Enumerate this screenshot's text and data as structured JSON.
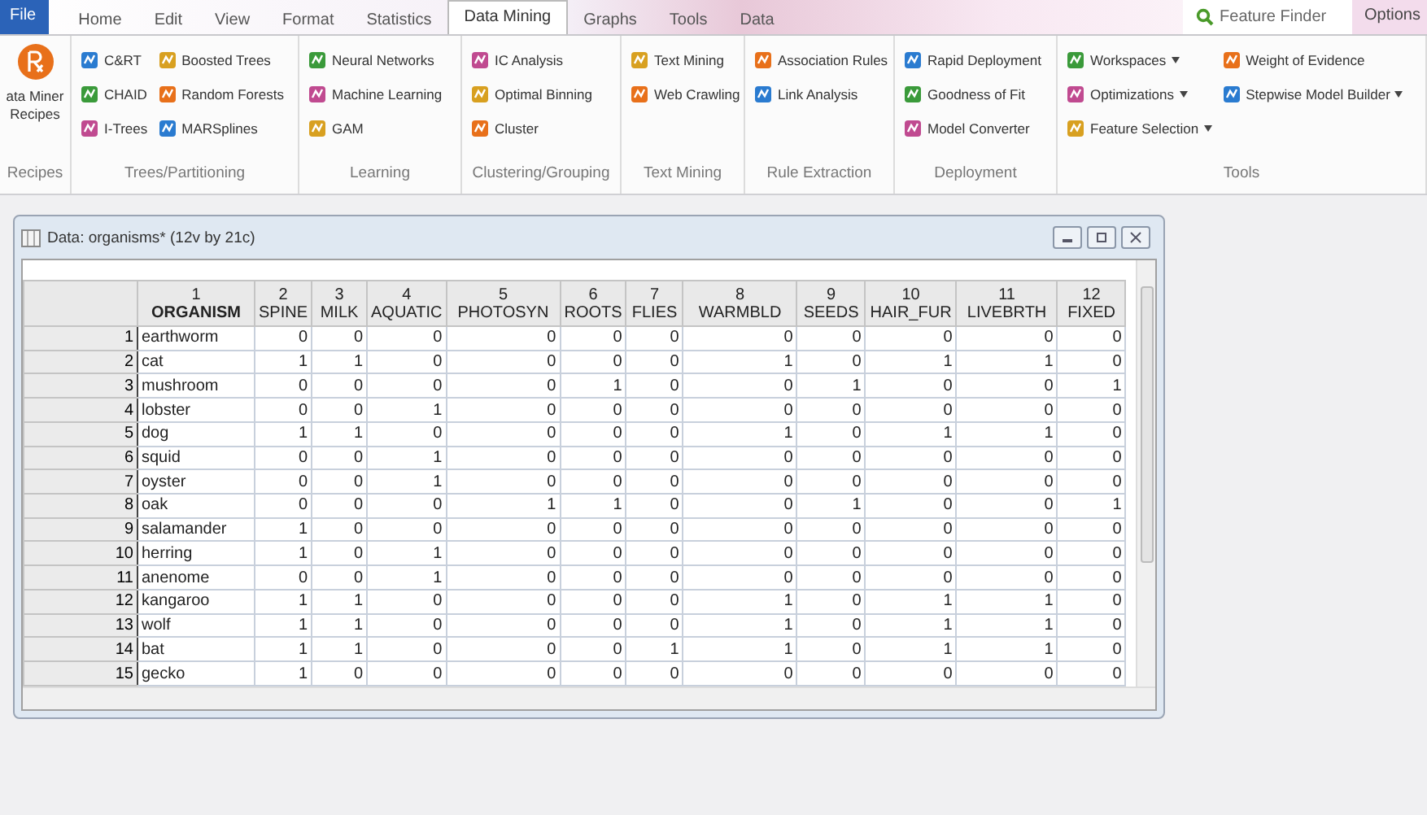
{
  "menu": {
    "file": "File",
    "tabs": [
      {
        "label": "Home",
        "selected": false
      },
      {
        "label": "Edit",
        "selected": false
      },
      {
        "label": "View",
        "selected": false
      },
      {
        "label": "Format",
        "selected": false
      },
      {
        "label": "Statistics",
        "selected": false
      },
      {
        "label": "Data Mining",
        "selected": true
      },
      {
        "label": "Graphs",
        "selected": false
      },
      {
        "label": "Tools",
        "selected": false
      },
      {
        "label": "Data",
        "selected": false
      }
    ],
    "finder": "Feature Finder",
    "options": "Options"
  },
  "ribbon": [
    {
      "title": "Recipes",
      "kind": "big",
      "items": [
        {
          "label": "ata Miner Recipes"
        }
      ]
    },
    {
      "title": "Trees/Partitioning",
      "kind": "grid",
      "items": [
        {
          "label": "C&RT"
        },
        {
          "label": "CHAID"
        },
        {
          "label": "I-Trees"
        },
        {
          "label": "Boosted Trees"
        },
        {
          "label": "Random Forests"
        },
        {
          "label": "MARSplines"
        }
      ]
    },
    {
      "title": "Learning",
      "kind": "list",
      "items": [
        {
          "label": "Neural Networks"
        },
        {
          "label": "Machine Learning"
        },
        {
          "label": "GAM"
        }
      ]
    },
    {
      "title": "Clustering/Grouping",
      "kind": "list",
      "items": [
        {
          "label": "IC Analysis"
        },
        {
          "label": "Optimal Binning"
        },
        {
          "label": "Cluster"
        }
      ]
    },
    {
      "title": "Text Mining",
      "kind": "list",
      "items": [
        {
          "label": "Text Mining"
        },
        {
          "label": "Web Crawling"
        }
      ]
    },
    {
      "title": "Rule Extraction",
      "kind": "list",
      "items": [
        {
          "label": "Association Rules"
        },
        {
          "label": "Link Analysis"
        }
      ]
    },
    {
      "title": "Deployment",
      "kind": "list",
      "items": [
        {
          "label": "Rapid Deployment"
        },
        {
          "label": "Goodness of Fit"
        },
        {
          "label": "Model Converter"
        }
      ]
    },
    {
      "title": "Tools",
      "kind": "grid",
      "items": [
        {
          "label": "Workspaces",
          "dropdown": true
        },
        {
          "label": "Optimizations",
          "dropdown": true
        },
        {
          "label": "Feature Selection",
          "dropdown": true
        },
        {
          "label": "Weight of Evidence",
          "dropdown": false
        },
        {
          "label": "Stepwise Model Builder",
          "dropdown": true
        }
      ]
    }
  ],
  "data_window": {
    "title": "Data: organisms* (12v by 21c)",
    "columns": [
      {
        "number": "1",
        "name": "ORGANISM"
      },
      {
        "number": "2",
        "name": "SPINE"
      },
      {
        "number": "3",
        "name": "MILK"
      },
      {
        "number": "4",
        "name": "AQUATIC"
      },
      {
        "number": "5",
        "name": "PHOTOSYN"
      },
      {
        "number": "6",
        "name": "ROOTS"
      },
      {
        "number": "7",
        "name": "FLIES"
      },
      {
        "number": "8",
        "name": "WARMBLD"
      },
      {
        "number": "9",
        "name": "SEEDS"
      },
      {
        "number": "10",
        "name": "HAIR_FUR"
      },
      {
        "number": "11",
        "name": "LIVEBRTH"
      },
      {
        "number": "12",
        "name": "FIXED"
      }
    ],
    "rows": [
      {
        "number": "1",
        "cells": [
          "earthworm",
          "0",
          "0",
          "0",
          "0",
          "0",
          "0",
          "0",
          "0",
          "0",
          "0",
          "0"
        ]
      },
      {
        "number": "2",
        "cells": [
          "cat",
          "1",
          "1",
          "0",
          "0",
          "0",
          "0",
          "1",
          "0",
          "1",
          "1",
          "0"
        ]
      },
      {
        "number": "3",
        "cells": [
          "mushroom",
          "0",
          "0",
          "0",
          "0",
          "1",
          "0",
          "0",
          "1",
          "0",
          "0",
          "1"
        ]
      },
      {
        "number": "4",
        "cells": [
          "lobster",
          "0",
          "0",
          "1",
          "0",
          "0",
          "0",
          "0",
          "0",
          "0",
          "0",
          "0"
        ]
      },
      {
        "number": "5",
        "cells": [
          "dog",
          "1",
          "1",
          "0",
          "0",
          "0",
          "0",
          "1",
          "0",
          "1",
          "1",
          "0"
        ]
      },
      {
        "number": "6",
        "cells": [
          "squid",
          "0",
          "0",
          "1",
          "0",
          "0",
          "0",
          "0",
          "0",
          "0",
          "0",
          "0"
        ]
      },
      {
        "number": "7",
        "cells": [
          "oyster",
          "0",
          "0",
          "1",
          "0",
          "0",
          "0",
          "0",
          "0",
          "0",
          "0",
          "0"
        ]
      },
      {
        "number": "8",
        "cells": [
          "oak",
          "0",
          "0",
          "0",
          "1",
          "1",
          "0",
          "0",
          "1",
          "0",
          "0",
          "1"
        ]
      },
      {
        "number": "9",
        "cells": [
          "salamander",
          "1",
          "0",
          "0",
          "0",
          "0",
          "0",
          "0",
          "0",
          "0",
          "0",
          "0"
        ]
      },
      {
        "number": "10",
        "cells": [
          "herring",
          "1",
          "0",
          "1",
          "0",
          "0",
          "0",
          "0",
          "0",
          "0",
          "0",
          "0"
        ]
      },
      {
        "number": "11",
        "cells": [
          "anenome",
          "0",
          "0",
          "1",
          "0",
          "0",
          "0",
          "0",
          "0",
          "0",
          "0",
          "0"
        ]
      },
      {
        "number": "12",
        "cells": [
          "kangaroo",
          "1",
          "1",
          "0",
          "0",
          "0",
          "0",
          "1",
          "0",
          "1",
          "1",
          "0"
        ]
      },
      {
        "number": "13",
        "cells": [
          "wolf",
          "1",
          "1",
          "0",
          "0",
          "0",
          "0",
          "1",
          "0",
          "1",
          "1",
          "0"
        ]
      },
      {
        "number": "14",
        "cells": [
          "bat",
          "1",
          "1",
          "0",
          "0",
          "0",
          "1",
          "1",
          "0",
          "1",
          "1",
          "0"
        ]
      },
      {
        "number": "15",
        "cells": [
          "gecko",
          "1",
          "0",
          "0",
          "0",
          "0",
          "0",
          "0",
          "0",
          "0",
          "0",
          "0"
        ]
      }
    ]
  }
}
